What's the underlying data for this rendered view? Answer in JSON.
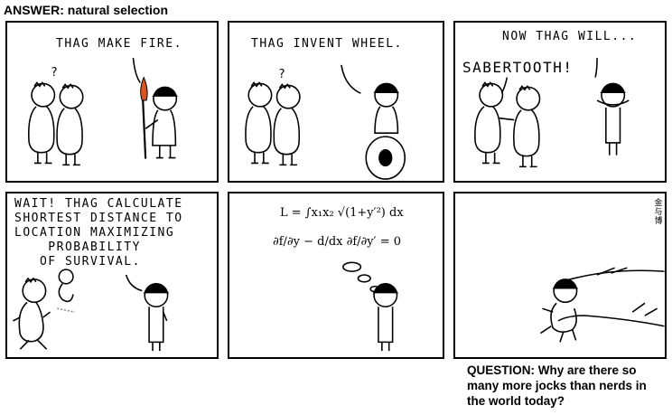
{
  "header": {
    "answer": "ANSWER: natural selection"
  },
  "panel1": {
    "caption": "THAG MAKE FIRE.",
    "question_mark": "?"
  },
  "panel2": {
    "caption": "THAG INVENT WHEEL.",
    "question_mark": "?"
  },
  "panel3": {
    "caption_1": "NOW THAG WILL...",
    "caption_2": "SABERTOOTH!"
  },
  "panel4": {
    "caption": "WAIT! THAG CALCULATE\nSHORTEST DISTANCE TO\nLOCATION MAXIMIZING\n    PROBABILITY\n   OF SURVIVAL."
  },
  "panel5": {
    "equation_1": "L = ∫x₁x₂ √(1+y′²) dx",
    "equation_2": "∂f/∂y − d/dx ∂f/∂y′ = 0"
  },
  "panel6": {
    "signature": "金与博"
  },
  "footer": {
    "question": "QUESTION: Why are there so many more jocks than nerds in the world today?"
  },
  "colors": {
    "ink": "#000000",
    "paper": "#ffffff",
    "flame": "#d9531e"
  }
}
